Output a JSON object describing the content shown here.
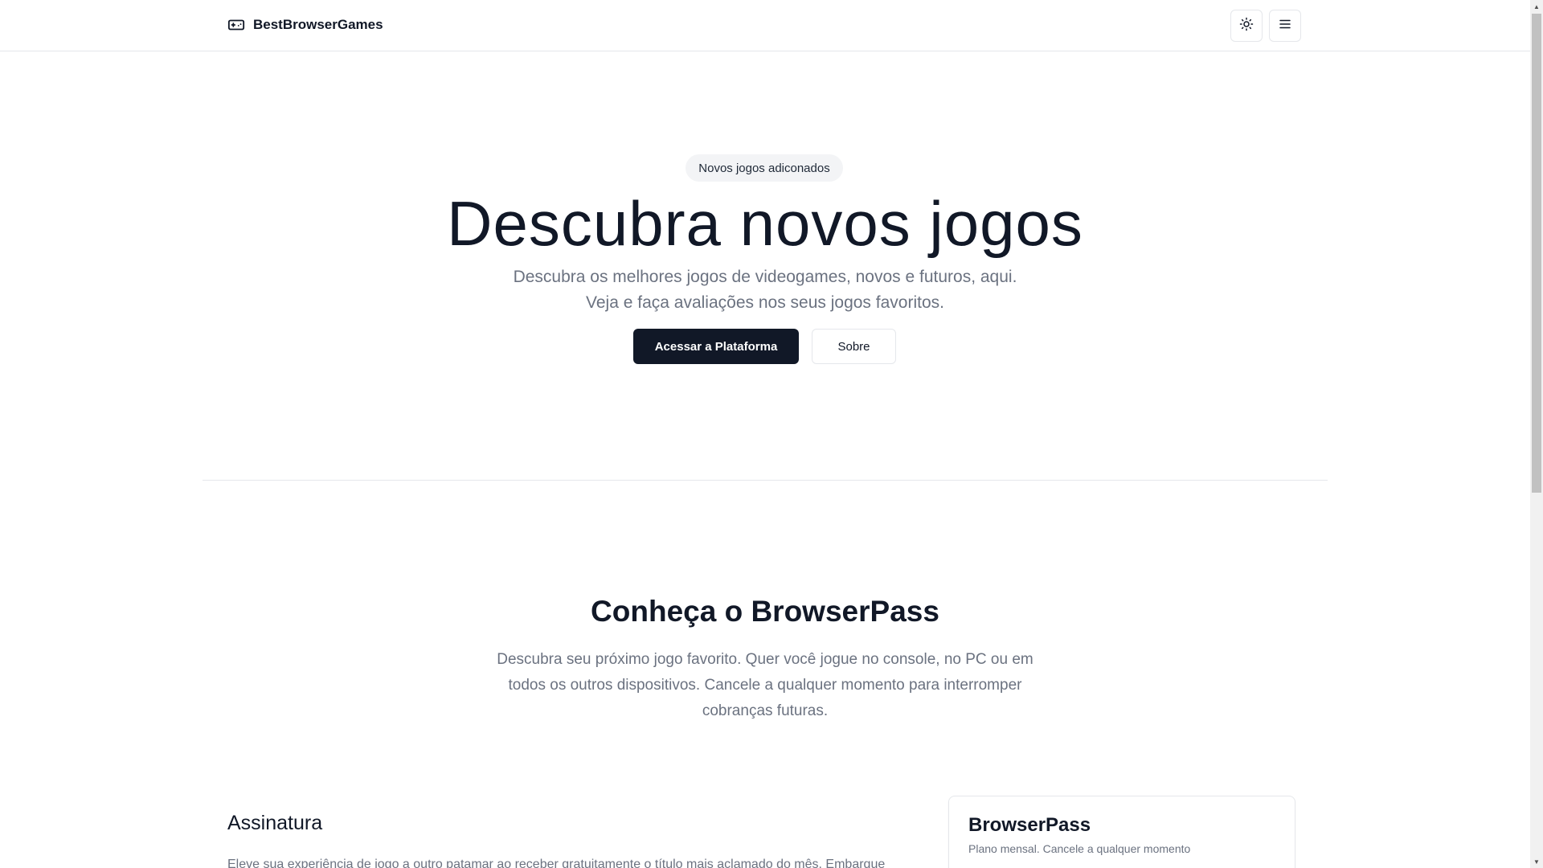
{
  "loading_bar": {
    "progress": 1.0
  },
  "header": {
    "brand_name": "BestBrowserGames",
    "brand_icon": "gamepad-icon",
    "theme_toggle_icon": "sun-icon",
    "menu_icon": "hamburger-menu-icon"
  },
  "hero": {
    "badge": "Novos jogos adiconados",
    "title": "Descubra novos jogos",
    "subtitle_line1": "Descubra os melhores jogos de videogames, novos e futuros, aqui.",
    "subtitle_line2": "Veja e faça avaliações nos seus jogos favoritos.",
    "primary_button": "Acessar a Plataforma",
    "secondary_button": "Sobre"
  },
  "browserpass_section": {
    "title": "Conheça o BrowserPass",
    "description": "Descubra seu próximo jogo favorito. Quer você jogue no console, no PC ou em todos os outros dispositivos. Cancele a qualquer momento para interromper cobranças futuras.",
    "subscription_heading": "Assinatura",
    "subscription_text": "Eleve sua experiência de jogo a outro patamar ao receber gratuitamente o título mais aclamado do mês. Embarque",
    "plan_card": {
      "title": "BrowserPass",
      "description": "Plano mensal. Cancele a qualquer momento"
    }
  },
  "colors": {
    "primary": "#111827",
    "muted_text": "#6b7280",
    "border": "#e5e7eb",
    "badge_bg": "#f3f4f6"
  }
}
